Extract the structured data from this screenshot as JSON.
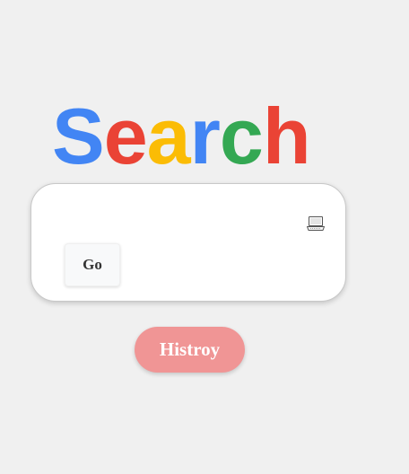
{
  "logo": {
    "letters": [
      {
        "char": "S",
        "color": "#4285f4"
      },
      {
        "char": "e",
        "color": "#ea4335"
      },
      {
        "char": "a",
        "color": "#fbbc05"
      },
      {
        "char": "r",
        "color": "#4285f4"
      },
      {
        "char": "c",
        "color": "#34a853"
      },
      {
        "char": "h",
        "color": "#ea4335"
      }
    ]
  },
  "search": {
    "value": "",
    "placeholder": "",
    "icon": "laptop-icon",
    "go_label": "Go"
  },
  "history": {
    "label": "Histroy",
    "color": "#f09595"
  }
}
